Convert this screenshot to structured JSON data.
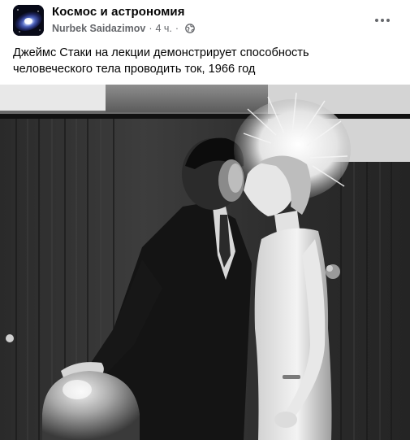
{
  "post": {
    "group_name": "Космос и астрономия",
    "author": "Nurbek Saidazimov",
    "separator": "·",
    "time": "4 ч.",
    "privacy_icon": "globe-icon",
    "more_icon": "more-horizontal-icon",
    "caption_line1": "Джеймс Стаки на лекции демонстрирует способность",
    "caption_line2": "человеческого тела проводить ток, 1966 год"
  },
  "colors": {
    "primary_text": "#050505",
    "secondary_text": "#65676b",
    "background": "#ffffff"
  }
}
